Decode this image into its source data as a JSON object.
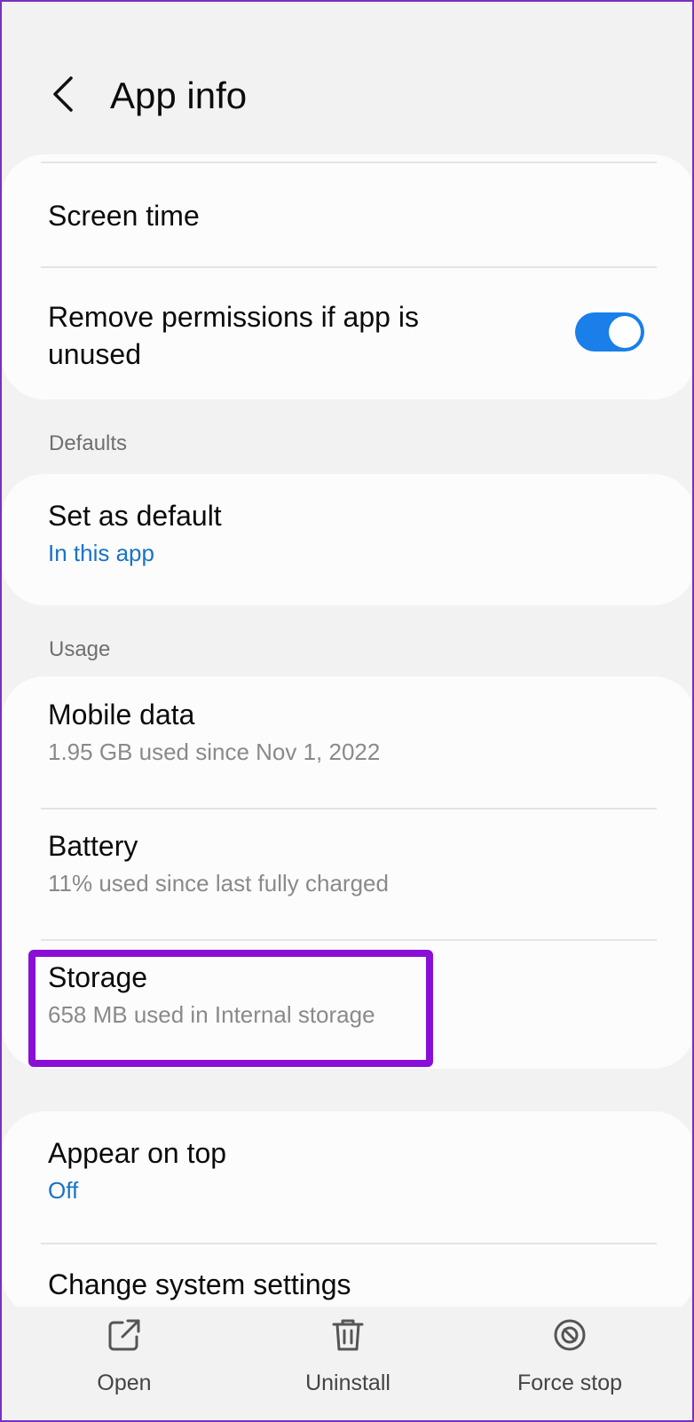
{
  "header": {
    "title": "App info",
    "back_icon": "chevron-left-icon"
  },
  "card1": {
    "items": [
      {
        "title": "Screen time"
      },
      {
        "title_line1": "Remove permissions if app is",
        "title_line2": "unused",
        "toggle_on": true
      }
    ]
  },
  "defaults": {
    "section_label": "Defaults",
    "items": [
      {
        "title": "Set as default",
        "subtitle": "In this app"
      }
    ]
  },
  "usage": {
    "section_label": "Usage",
    "items": [
      {
        "title": "Mobile data",
        "subtitle": "1.95 GB used since Nov 1, 2022"
      },
      {
        "title": "Battery",
        "subtitle": "11% used since last fully charged"
      },
      {
        "title": "Storage",
        "subtitle": "658 MB used in Internal storage"
      }
    ]
  },
  "advanced": {
    "items": [
      {
        "title": "Appear on top",
        "subtitle": "Off"
      },
      {
        "title": "Change system settings"
      }
    ]
  },
  "bottom_bar": {
    "open": {
      "label": "Open",
      "icon": "open-external-icon"
    },
    "uninstall": {
      "label": "Uninstall",
      "icon": "trash-icon"
    },
    "force_stop": {
      "label": "Force stop",
      "icon": "block-icon"
    }
  },
  "colors": {
    "accent": "#1a7fe8",
    "link": "#1a73c6",
    "highlight": "#8a0fd6",
    "background": "#f2f2f2"
  }
}
